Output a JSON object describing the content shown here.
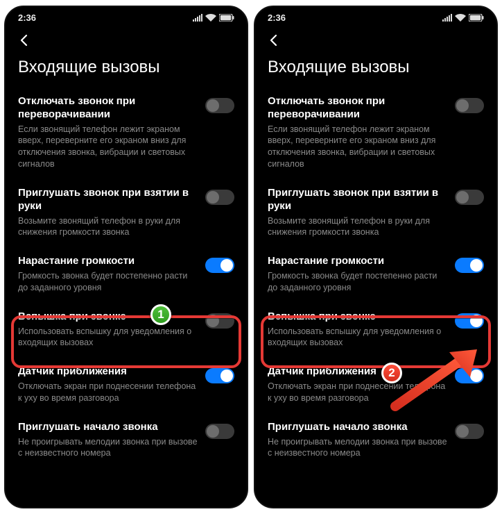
{
  "status": {
    "time": "2:36"
  },
  "nav": {
    "back": "Назад"
  },
  "page_title": "Входящие вызовы",
  "settings": [
    {
      "title": "Отключать звонок при переворачивании",
      "desc": "Если звонящий телефон лежит экраном вверх, переверните его экраном вниз для отключения звонка, вибрации и световых сигналов",
      "state_left": false,
      "state_right": false
    },
    {
      "title": "Приглушать звонок при взятии в руки",
      "desc": "Возьмите звонящий телефон в руки для снижения громкости звонка",
      "state_left": false,
      "state_right": false
    },
    {
      "title": "Нарастание громкости",
      "desc": "Громкость звонка будет постепенно расти до заданного уровня",
      "state_left": true,
      "state_right": true
    },
    {
      "title": "Вспышка при звонке",
      "desc": "Использовать вспышку для уведомления о входящих вызовах",
      "state_left": false,
      "state_right": true
    },
    {
      "title": "Датчик приближения",
      "desc": "Отключать экран при поднесении телефона к уху во время разговора",
      "state_left": true,
      "state_right": true
    },
    {
      "title": "Приглушать начало звонка",
      "desc": "Не проигрывать мелодии звонка при вызове с неизвестного номера",
      "state_left": false,
      "state_right": false
    }
  ],
  "badges": {
    "one": "1",
    "two": "2"
  }
}
